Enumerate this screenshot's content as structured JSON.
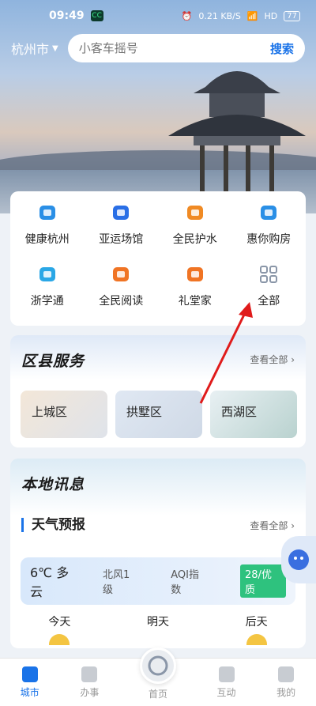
{
  "status": {
    "time": "09:49",
    "app_badge": "CC",
    "net_speed": "0.21 KB/S",
    "signal": "HD",
    "battery": "77"
  },
  "topbar": {
    "city": "杭州市",
    "search_placeholder": "小客车摇号",
    "search_button": "搜索"
  },
  "services": [
    {
      "label": "健康杭州",
      "icon": "heart-pulse-icon",
      "color": "#2a8fe6"
    },
    {
      "label": "亚运场馆",
      "icon": "stadium-icon",
      "color": "#2a6fe6"
    },
    {
      "label": "全民护水",
      "icon": "water-shield-icon",
      "color": "#f08a24"
    },
    {
      "label": "惠你购房",
      "icon": "house-bag-icon",
      "color": "#2a8fe6"
    },
    {
      "label": "浙学通",
      "icon": "study-icon",
      "color": "#2aa7e6"
    },
    {
      "label": "全民阅读",
      "icon": "book-icon",
      "color": "#f07424"
    },
    {
      "label": "礼堂家",
      "icon": "hall-icon",
      "color": "#f07424"
    },
    {
      "label": "全部",
      "icon": "grid-icon",
      "color": "#8a96a8"
    }
  ],
  "district": {
    "title": "区县服务",
    "more": "查看全部 ›",
    "items": [
      "上城区",
      "拱墅区",
      "西湖区"
    ]
  },
  "local": {
    "title": "本地讯息"
  },
  "weather": {
    "title": "天气预报",
    "more": "查看全部 ›",
    "temp": "6℃ 多云",
    "wind": "北风1级",
    "aqi_label": "AQI指数",
    "aqi_value": "28/优质",
    "days": [
      "今天",
      "明天",
      "后天"
    ]
  },
  "tabs": {
    "city": "城市",
    "affairs": "办事",
    "home": "首页",
    "interact": "互动",
    "mine": "我的"
  }
}
